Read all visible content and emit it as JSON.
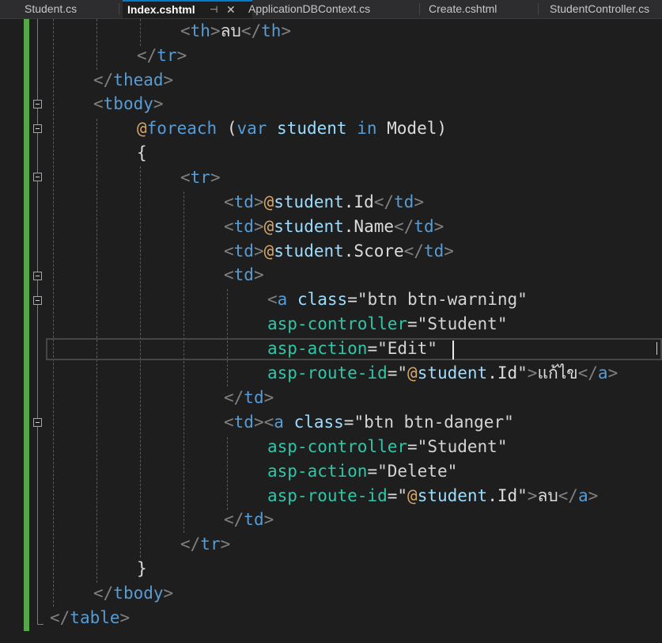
{
  "tabs": [
    {
      "label": "Student.cs",
      "active": false
    },
    {
      "label": "Index.cshtml",
      "active": true
    },
    {
      "label": "ApplicationDBContext.cs",
      "active": false
    },
    {
      "label": "Create.cshtml",
      "active": false
    },
    {
      "label": "StudentController.cs",
      "active": false
    }
  ],
  "tab_icons": {
    "pin": "pin-icon",
    "close": "close-icon"
  },
  "code": {
    "l1_text": "ลบ",
    "l1_tag": "th",
    "l2_tag": "tr",
    "l3_tag": "thead",
    "l4_tag": "tbody",
    "l5_at": "@",
    "l5_kw": "foreach",
    "l5_open": " (",
    "l5_var": "var",
    "l5_name": " student ",
    "l5_in": "in",
    "l5_model": " Model)",
    "l6_brace": "{",
    "l7_tag": "tr",
    "td": "td",
    "at": "@",
    "student": "student",
    "dot_id": ".Id",
    "dot_name": ".Name",
    "dot_score": ".Score",
    "a_tag": "a",
    "class_attr": "class",
    "eq": "=",
    "edit_class": "\"btn btn-warning\"",
    "delete_class": "\"btn btn-danger\"",
    "asp_controller": "asp-controller",
    "asp_action": "asp-action",
    "asp_route_id": "asp-route-id",
    "controller_val": "\"Student\"",
    "edit_action": "\"Edit\"",
    "delete_action": "\"Delete\"",
    "quote": "\"",
    "edit_text": "แก้ไข",
    "delete_text": "ลบ",
    "close_brace": "}",
    "table_tag": "table"
  },
  "colors": {
    "gutter": "#57a64a",
    "tag": "#569cd6",
    "attribute": "#2ec7a8",
    "razor": "#d3a66d"
  }
}
